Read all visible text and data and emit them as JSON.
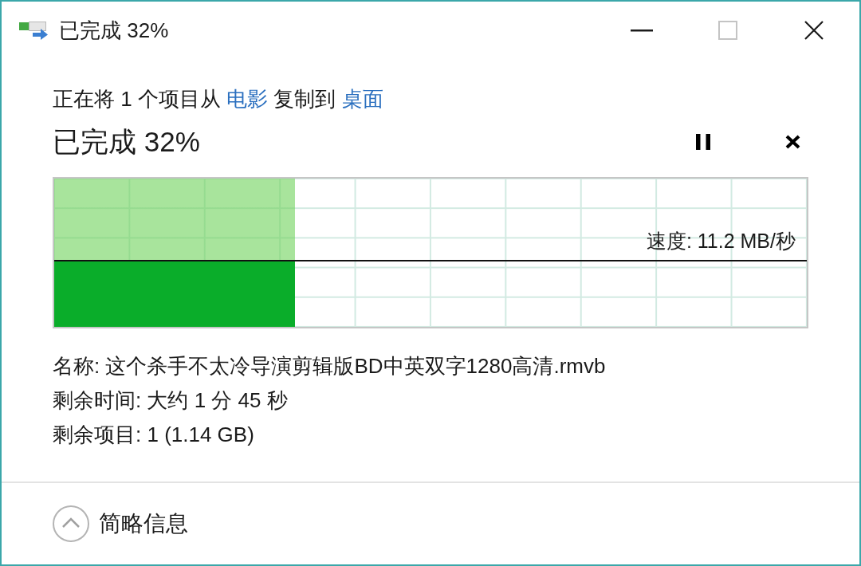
{
  "window": {
    "title": "已完成 32%",
    "maximize": {
      "disabled": true
    }
  },
  "copy_description": [
    {
      "kind": "text",
      "text": "正在将 1 个项目从"
    },
    {
      "kind": "link",
      "text": "电影"
    },
    {
      "kind": "text",
      "text": "复制到"
    },
    {
      "kind": "link",
      "text": "桌面"
    }
  ],
  "status": {
    "text": "已完成 32%",
    "paused": false
  },
  "progress": {
    "level": 0.32,
    "speed": "速度: 11.2 MB/秒"
  },
  "details": [
    "名称: 这个杀手不太冷导演剪辑版BD中英双字1280高清.rmvb",
    "剩余时间: 大约 1 分 45 秒",
    "剩余项目: 1 (1.14 GB)"
  ],
  "details_toggle": {
    "label": "简略信息",
    "expanded": true
  }
}
